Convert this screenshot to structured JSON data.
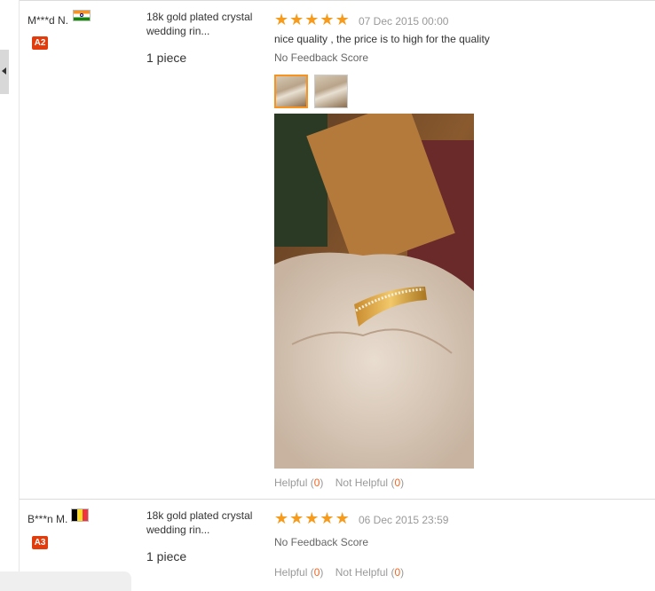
{
  "reviews": [
    {
      "buyer": "M***d N.",
      "country_flag": "flag-india-icon",
      "level": "A2",
      "product": "18k gold plated crystal wedding rin...",
      "quantity": "1 piece",
      "rating": 5,
      "date": "07 Dec 2015 00:00",
      "comment": "nice quality , the price is to high for the quality",
      "feedback_score": "No Feedback Score",
      "photos": [
        "photo-1",
        "photo-2"
      ],
      "helpful_label": "Helpful",
      "helpful_count": "0",
      "not_helpful_label": "Not Helpful",
      "not_helpful_count": "0"
    },
    {
      "buyer": "B***n M.",
      "country_flag": "flag-belgium-icon",
      "level": "A3",
      "product": "18k gold plated crystal wedding rin...",
      "quantity": "1 piece",
      "rating": 5,
      "date": "06 Dec 2015 23:59",
      "comment": "",
      "feedback_score": "No Feedback Score",
      "photos": [],
      "helpful_label": "Helpful",
      "helpful_count": "0",
      "not_helpful_label": "Not Helpful",
      "not_helpful_count": "0"
    }
  ],
  "colors": {
    "star": "#f79b1c",
    "badge": "#e33c0c",
    "count": "#f26522"
  }
}
